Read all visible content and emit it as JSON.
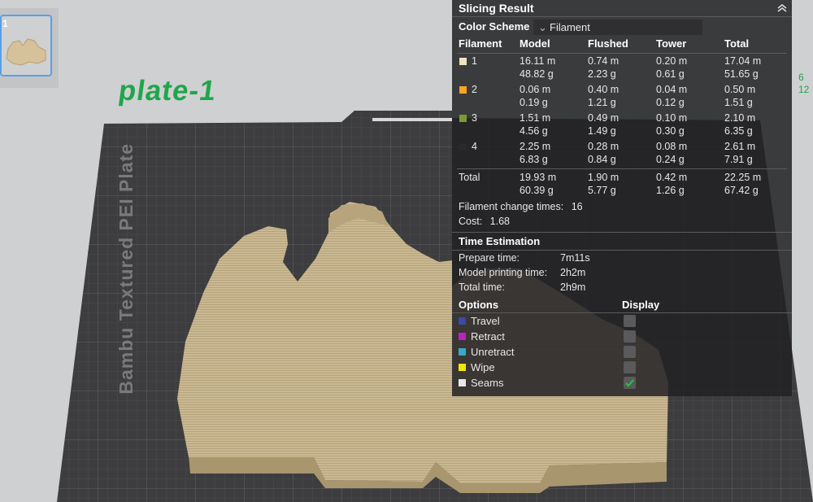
{
  "plate": {
    "name": "plate-1",
    "bed_label": "Bambu Textured PEI Plate",
    "thumbnail_index": "1"
  },
  "edge_numbers": [
    "6",
    "12"
  ],
  "panel": {
    "title": "Slicing Result",
    "color_scheme_label": "Color Scheme",
    "color_scheme_value": "Filament",
    "headers": [
      "Filament",
      "Model",
      "Flushed",
      "Tower",
      "Total"
    ],
    "rows": [
      {
        "id": "1",
        "color": "#f0e2c2",
        "model": [
          "16.11 m",
          "48.82 g"
        ],
        "flushed": [
          "0.74 m",
          "2.23 g"
        ],
        "tower": [
          "0.20 m",
          "0.61 g"
        ],
        "total": [
          "17.04 m",
          "51.65 g"
        ]
      },
      {
        "id": "2",
        "color": "#f5a623",
        "model": [
          "0.06 m",
          "0.19 g"
        ],
        "flushed": [
          "0.40 m",
          "1.21 g"
        ],
        "tower": [
          "0.04 m",
          "0.12 g"
        ],
        "total": [
          "0.50 m",
          "1.51 g"
        ]
      },
      {
        "id": "3",
        "color": "#7c9a2e",
        "model": [
          "1.51 m",
          "4.56 g"
        ],
        "flushed": [
          "0.49 m",
          "1.49 g"
        ],
        "tower": [
          "0.10 m",
          "0.30 g"
        ],
        "total": [
          "2.10 m",
          "6.35 g"
        ]
      },
      {
        "id": "4",
        "color": "#2a2a2a",
        "model": [
          "2.25 m",
          "6.83 g"
        ],
        "flushed": [
          "0.28 m",
          "0.84 g"
        ],
        "tower": [
          "0.08 m",
          "0.24 g"
        ],
        "total": [
          "2.61 m",
          "7.91 g"
        ]
      }
    ],
    "total_row": {
      "label": "Total",
      "model": [
        "19.93 m",
        "60.39 g"
      ],
      "flushed": [
        "1.90 m",
        "5.77 g"
      ],
      "tower": [
        "0.42 m",
        "1.26 g"
      ],
      "total": [
        "22.25 m",
        "67.42 g"
      ]
    },
    "filament_change_label": "Filament change times:",
    "filament_change_value": "16",
    "cost_label": "Cost:",
    "cost_value": "1.68",
    "time_title": "Time Estimation",
    "time_rows": [
      {
        "label": "Prepare time:",
        "value": "7m11s"
      },
      {
        "label": "Model printing time:",
        "value": "2h2m"
      },
      {
        "label": "Total time:",
        "value": "2h9m"
      }
    ],
    "options_label": "Options",
    "display_label": "Display",
    "options": [
      {
        "label": "Travel",
        "color": "#3a4aa8",
        "checked": false
      },
      {
        "label": "Retract",
        "color": "#c020c0",
        "checked": false
      },
      {
        "label": "Unretract",
        "color": "#3aa8c8",
        "checked": false
      },
      {
        "label": "Wipe",
        "color": "#f2e600",
        "checked": false
      },
      {
        "label": "Seams",
        "color": "#e8e8e8",
        "checked": true
      }
    ],
    "colors": {
      "accent_green": "#1fa64a",
      "model_tan": "#c8b690",
      "bed": "#404042"
    }
  }
}
